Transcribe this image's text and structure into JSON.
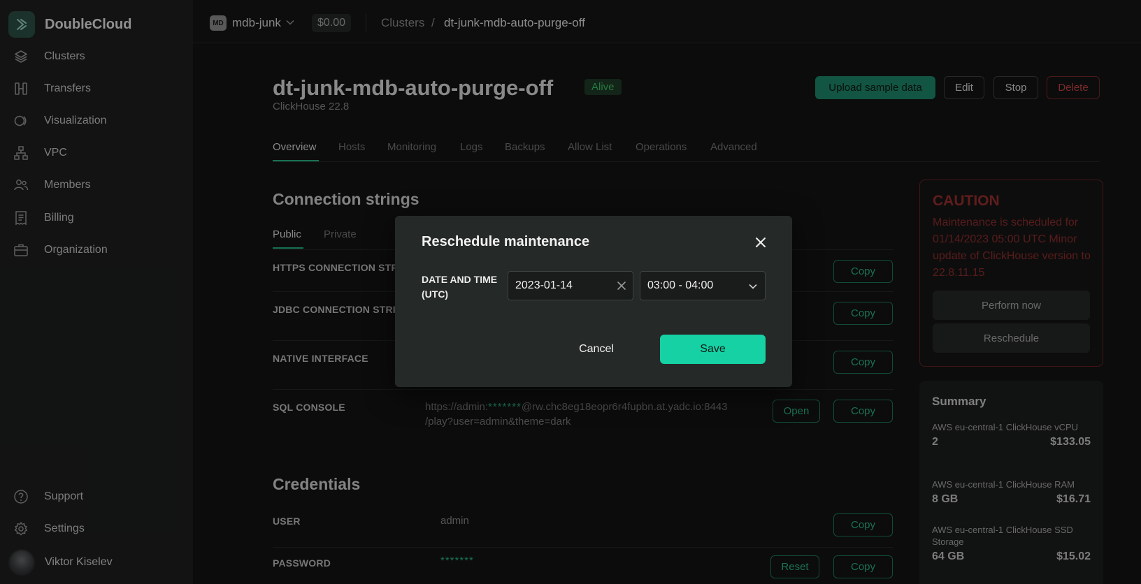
{
  "sidebar": {
    "brand": "DoubleCloud",
    "items": [
      {
        "label": "Clusters",
        "icon": "stack-icon"
      },
      {
        "label": "Transfers",
        "icon": "transfer-icon"
      },
      {
        "label": "Visualization",
        "icon": "visualization-icon"
      },
      {
        "label": "VPC",
        "icon": "network-icon"
      },
      {
        "label": "Members",
        "icon": "members-icon"
      },
      {
        "label": "Billing",
        "icon": "receipt-icon"
      },
      {
        "label": "Organization",
        "icon": "briefcase-icon"
      }
    ],
    "support": "Support",
    "settings": "Settings",
    "user": "Viktor Kiselev"
  },
  "topbar": {
    "org_badge": "MD",
    "org_name": "mdb-junk",
    "balance": "$0.00",
    "breadcrumb_root": "Clusters",
    "breadcrumb_sep": "/",
    "breadcrumb_current": "dt-junk-mdb-auto-purge-off"
  },
  "cluster": {
    "name": "dt-junk-mdb-auto-purge-off",
    "status": "Alive",
    "engine": "ClickHouse 22.8"
  },
  "actions": {
    "upload": "Upload sample data",
    "edit": "Edit",
    "stop": "Stop",
    "delete": "Delete"
  },
  "tabs": [
    "Overview",
    "Hosts",
    "Monitoring",
    "Logs",
    "Backups",
    "Allow List",
    "Operations",
    "Advanced"
  ],
  "connection": {
    "title": "Connection strings",
    "subtabs": [
      "Public",
      "Private"
    ],
    "rows": [
      {
        "label": "HTTPS CONNECTION STRING"
      },
      {
        "label": "JDBC CONNECTION STRING"
      },
      {
        "label": "NATIVE INTERFACE"
      },
      {
        "label": "SQL CONSOLE"
      }
    ],
    "sql_url_prefix": "https://admin:",
    "sql_url_mask": "*******",
    "sql_url_suffix": "@rw.chc8eg18eopr6r4fupbn.at.yadc.io:8443 /play?user=admin&theme=dark",
    "copy": "Copy",
    "open": "Open"
  },
  "credentials": {
    "title": "Credentials",
    "user_label": "USER",
    "user_value": "admin",
    "password_label": "PASSWORD",
    "password_value": "*******",
    "reset": "Reset",
    "copy": "Copy"
  },
  "caution": {
    "title": "CAUTION",
    "text": "Maintenance is scheduled for 01/14/2023 05:00 UTC Minor update of ClickHouse version to 22.8.11.15",
    "perform": "Perform now",
    "reschedule": "Reschedule"
  },
  "summary": {
    "title": "Summary",
    "items": [
      {
        "name": "AWS eu-central-1 ClickHouse vCPU",
        "qty": "2",
        "price": "$133.05"
      },
      {
        "name": "AWS eu-central-1 ClickHouse RAM",
        "qty": "8 GB",
        "price": "$16.71"
      },
      {
        "name": "AWS eu-central-1 ClickHouse SSD Storage",
        "qty": "64 GB",
        "price": "$15.02"
      }
    ]
  },
  "modal": {
    "title": "Reschedule maintenance",
    "field_label": "DATE AND TIME (UTC)",
    "date_value": "2023-01-14",
    "time_value": "03:00 - 04:00",
    "cancel": "Cancel",
    "save": "Save"
  },
  "colors": {
    "accent": "#15d1a4",
    "danger": "#c74444",
    "status_ok": "#3ec46a"
  }
}
